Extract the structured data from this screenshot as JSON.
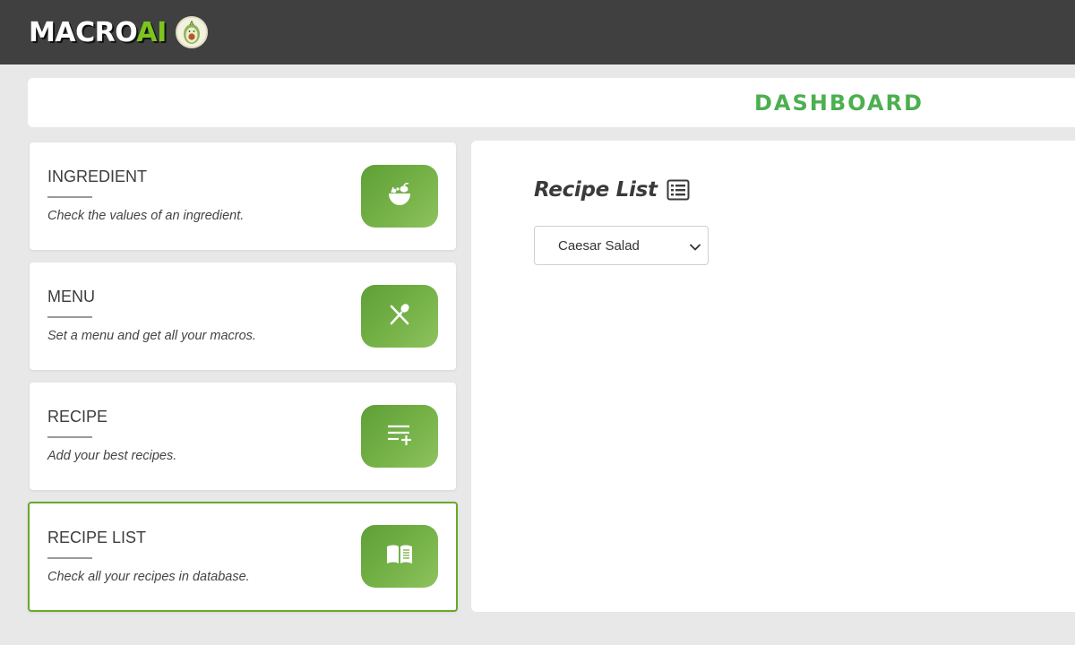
{
  "navbar": {
    "logo_main": "MACRO",
    "logo_accent": "AI"
  },
  "dashboard": {
    "title": "DASHBOARD"
  },
  "cards": [
    {
      "title": "INGREDIENT",
      "description": "Check the values of an ingredient.",
      "icon": "salad-bowl-icon"
    },
    {
      "title": "MENU",
      "description": "Set a menu and get all your macros.",
      "icon": "fork-spoon-icon"
    },
    {
      "title": "RECIPE",
      "description": "Add your best recipes.",
      "icon": "list-add-icon"
    },
    {
      "title": "RECIPE LIST",
      "description": "Check all your recipes in database.",
      "icon": "open-book-icon",
      "active": true
    }
  ],
  "main": {
    "title": "Recipe List",
    "title_icon": "list-icon",
    "select": {
      "selected": "Caesar Salad"
    }
  },
  "colors": {
    "navbar": "#404040",
    "accent_green": "#4caf50",
    "logo_green": "#7cc41f",
    "button_green": "#6aa72c",
    "background": "#e8e8e8"
  }
}
